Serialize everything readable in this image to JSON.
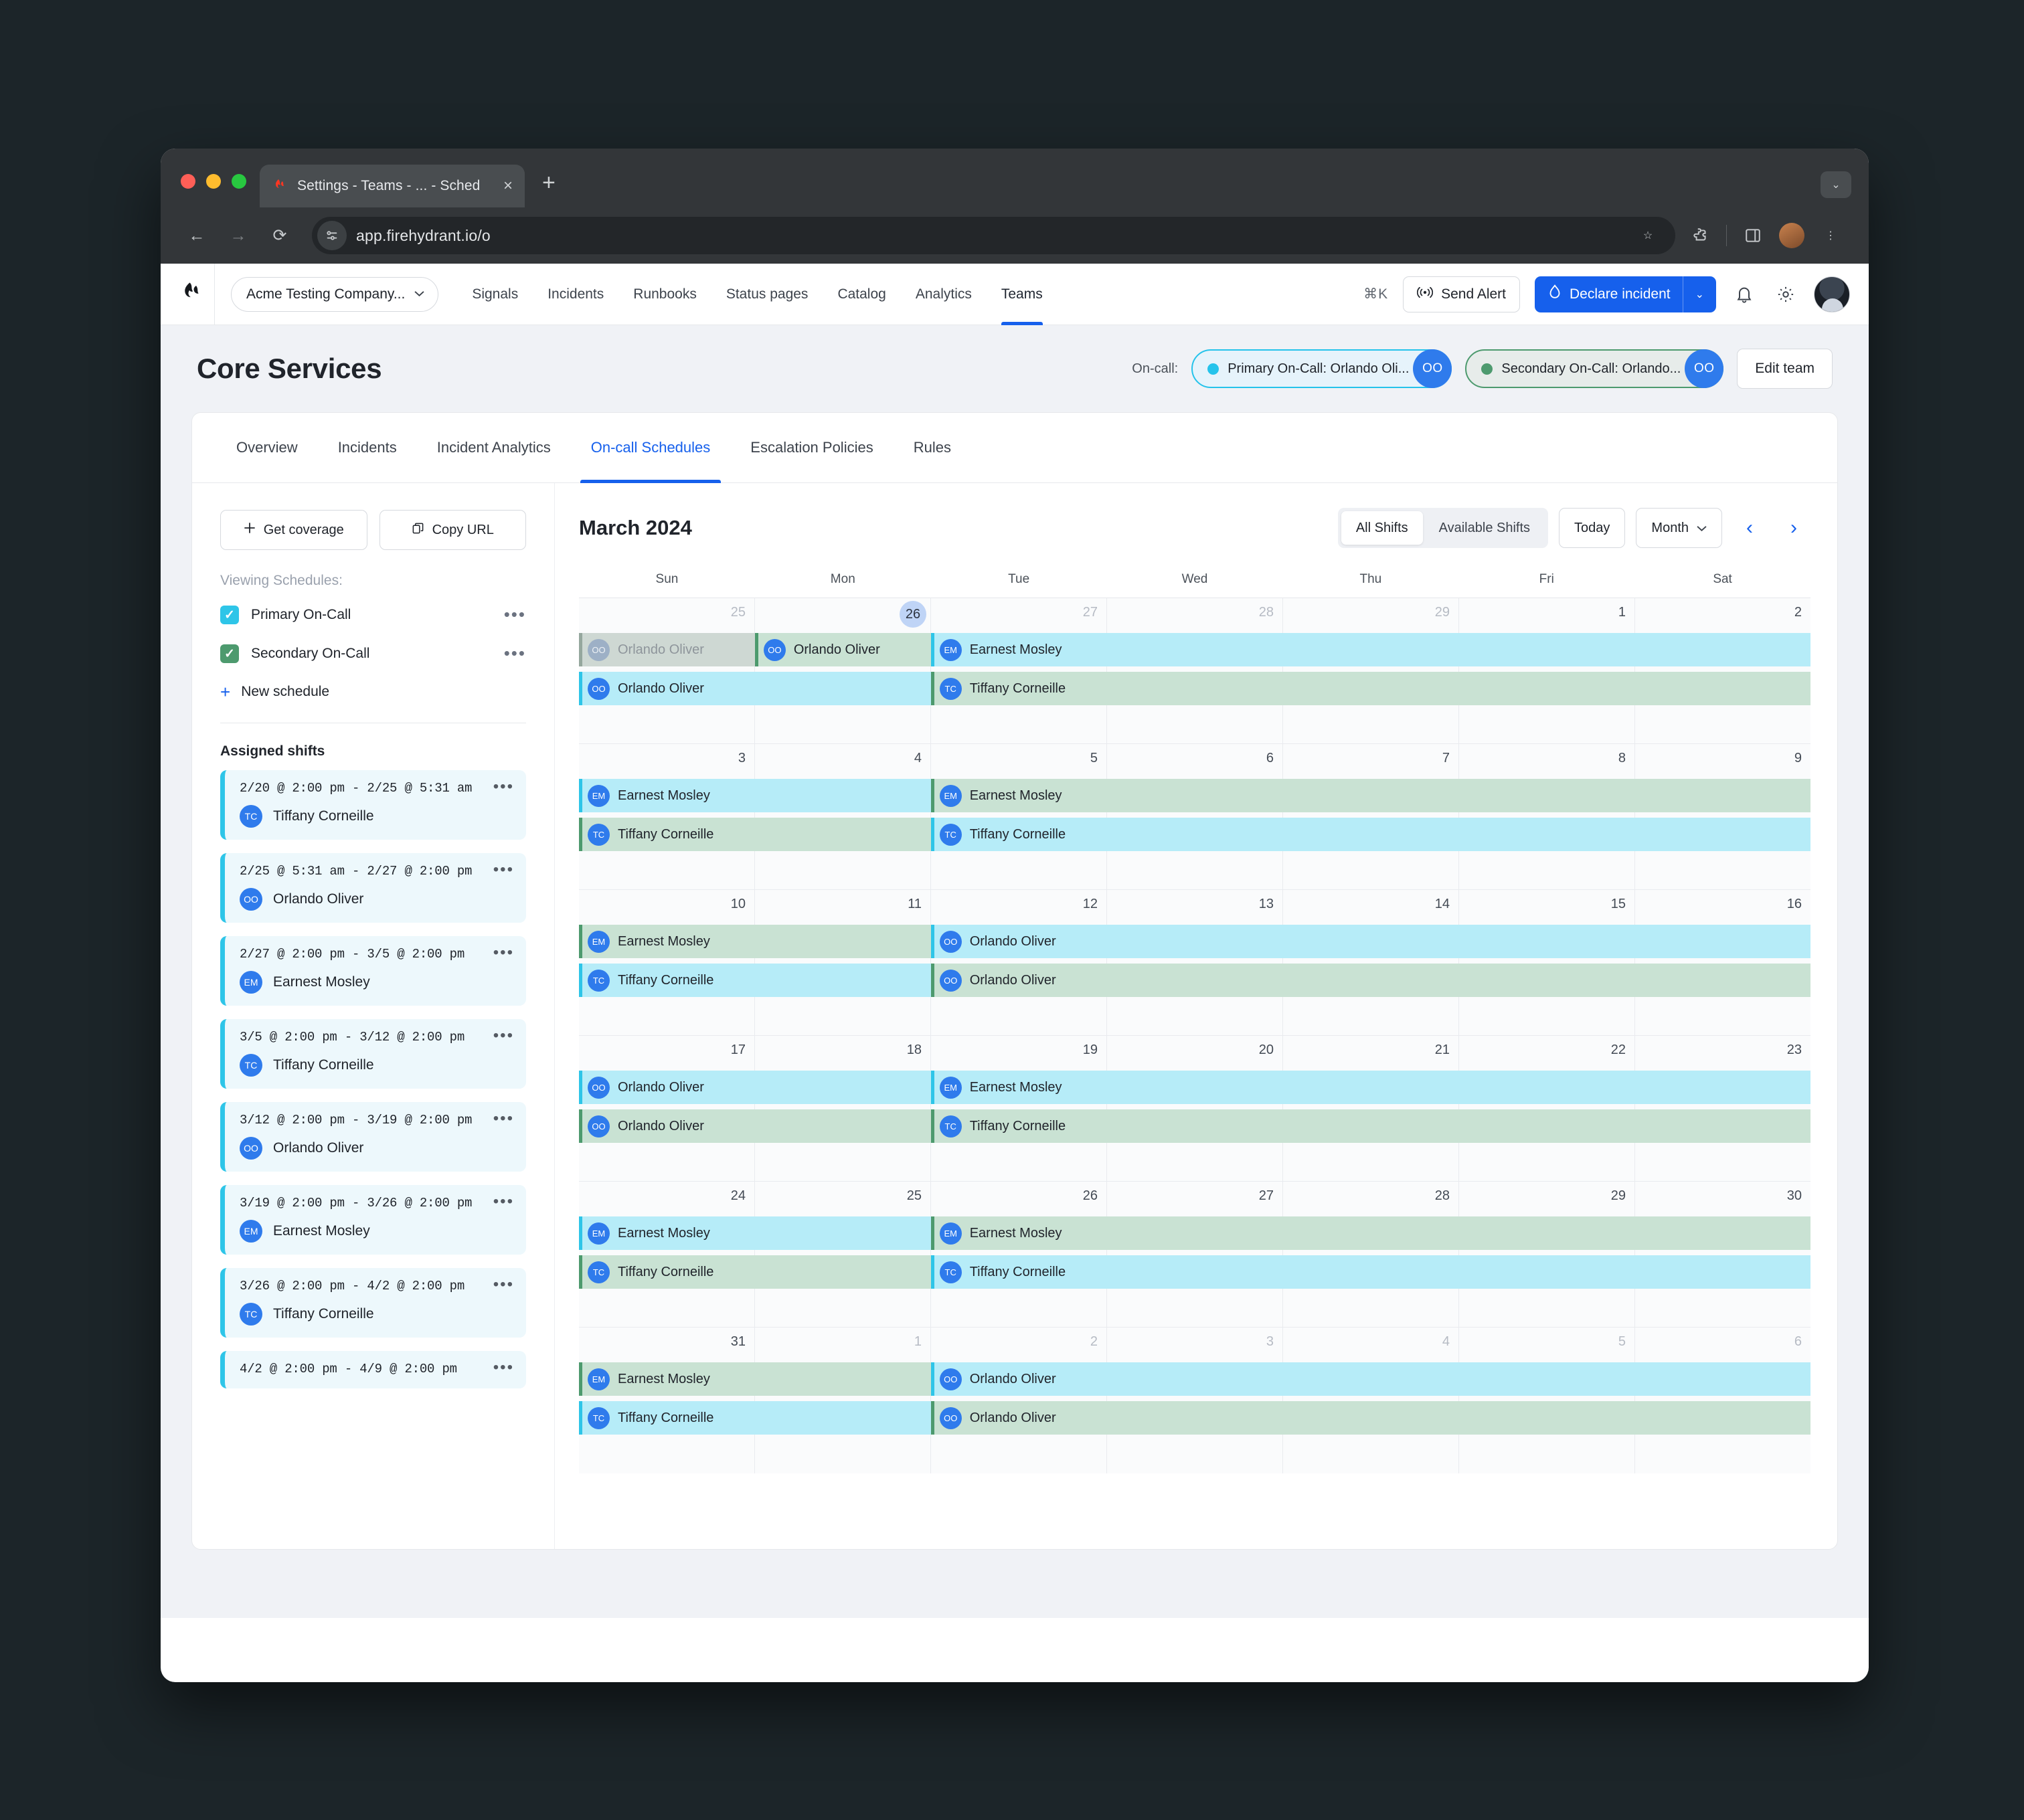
{
  "browser": {
    "tab_title": "Settings - Teams - ... - Sched",
    "tab_favicon": "firehydrant-logo-icon",
    "close_label": "×",
    "newtab_label": "+",
    "window_chevron": "⌄",
    "back": "←",
    "forward": "→",
    "reload": "⟳",
    "url": "app.firehydrant.io/o",
    "star": "☆",
    "menu": "⋮"
  },
  "appnav": {
    "org": "Acme Testing Company...",
    "links": [
      "Signals",
      "Incidents",
      "Runbooks",
      "Status pages",
      "Catalog",
      "Analytics",
      "Teams"
    ],
    "active_link": "Teams",
    "shortcut": "⌘K",
    "send_alert": "Send Alert",
    "declare_incident": "Declare incident",
    "declare_caret": "⌄"
  },
  "header": {
    "title": "Core Services",
    "oncall_label": "On-call:",
    "pills": [
      {
        "text": "Primary On-Call: Orlando Oli...",
        "initials": "OO",
        "color": "#25c3eb"
      },
      {
        "text": "Secondary On-Call: Orlando...",
        "initials": "OO",
        "color": "#4d9a6e"
      }
    ],
    "edit_team": "Edit team"
  },
  "tabs": {
    "items": [
      "Overview",
      "Incidents",
      "Incident Analytics",
      "On-call Schedules",
      "Escalation Policies",
      "Rules"
    ],
    "active": "On-call Schedules"
  },
  "sidebar": {
    "get_coverage": "Get coverage",
    "copy_url": "Copy URL",
    "viewing_label": "Viewing Schedules:",
    "schedules": [
      {
        "name": "Primary On-Call",
        "checked": true,
        "color": "#2ec5e8"
      },
      {
        "name": "Secondary On-Call",
        "checked": true,
        "color": "#4d9a6e"
      }
    ],
    "new_schedule": "New schedule",
    "assigned_title": "Assigned shifts",
    "shifts": [
      {
        "time": "2/20 @ 2:00 pm - 2/25 @ 5:31 am",
        "person": "Tiffany Corneille",
        "initials": "TC"
      },
      {
        "time": "2/25 @ 5:31 am - 2/27 @ 2:00 pm",
        "person": "Orlando Oliver",
        "initials": "OO"
      },
      {
        "time": "2/27 @ 2:00 pm - 3/5 @ 2:00 pm",
        "person": "Earnest Mosley",
        "initials": "EM"
      },
      {
        "time": "3/5 @ 2:00 pm - 3/12 @ 2:00 pm",
        "person": "Tiffany Corneille",
        "initials": "TC"
      },
      {
        "time": "3/12 @ 2:00 pm - 3/19 @ 2:00 pm",
        "person": "Orlando Oliver",
        "initials": "OO"
      },
      {
        "time": "3/19 @ 2:00 pm - 3/26 @ 2:00 pm",
        "person": "Earnest Mosley",
        "initials": "EM"
      },
      {
        "time": "3/26 @ 2:00 pm - 4/2 @ 2:00 pm",
        "person": "Tiffany Corneille",
        "initials": "TC"
      },
      {
        "time": "4/2 @ 2:00 pm - 4/9 @ 2:00 pm",
        "person": "",
        "initials": ""
      }
    ],
    "dots": "•••"
  },
  "calendar": {
    "month": "March 2024",
    "segments": [
      "All Shifts",
      "Available Shifts"
    ],
    "segment_active": "All Shifts",
    "today": "Today",
    "view": "Month",
    "prev": "‹",
    "next": "›",
    "dow": [
      "Sun",
      "Mon",
      "Tue",
      "Wed",
      "Thu",
      "Fri",
      "Sat"
    ],
    "weeks": [
      {
        "days": [
          {
            "n": "25",
            "muted": true
          },
          {
            "n": "26",
            "today": true
          },
          {
            "n": "27",
            "muted": true
          },
          {
            "n": "28",
            "muted": true
          },
          {
            "n": "29",
            "muted": true
          },
          {
            "n": "1"
          },
          {
            "n": "2"
          }
        ],
        "rows": [
          [
            {
              "person": "Orlando Oliver",
              "initials": "OO",
              "start": 0,
              "span": 1,
              "style": "past"
            },
            {
              "person": "Orlando Oliver",
              "initials": "OO",
              "start": 1,
              "span": 1,
              "style": "green"
            },
            {
              "person": "Earnest Mosley",
              "initials": "EM",
              "start": 2,
              "span": 5,
              "style": "cyan"
            }
          ],
          [
            {
              "person": "Orlando Oliver",
              "initials": "OO",
              "start": 0,
              "span": 2,
              "style": "cyan"
            },
            {
              "person": "Tiffany Corneille",
              "initials": "TC",
              "start": 2,
              "span": 5,
              "style": "green"
            }
          ]
        ]
      },
      {
        "days": [
          {
            "n": "3"
          },
          {
            "n": "4"
          },
          {
            "n": "5"
          },
          {
            "n": "6"
          },
          {
            "n": "7"
          },
          {
            "n": "8"
          },
          {
            "n": "9"
          }
        ],
        "rows": [
          [
            {
              "person": "Earnest Mosley",
              "initials": "EM",
              "start": 0,
              "span": 2,
              "style": "cyan"
            },
            {
              "person": "Earnest Mosley",
              "initials": "EM",
              "start": 2,
              "span": 5,
              "style": "green"
            }
          ],
          [
            {
              "person": "Tiffany Corneille",
              "initials": "TC",
              "start": 0,
              "span": 2,
              "style": "green"
            },
            {
              "person": "Tiffany Corneille",
              "initials": "TC",
              "start": 2,
              "span": 5,
              "style": "cyan"
            }
          ]
        ]
      },
      {
        "days": [
          {
            "n": "10"
          },
          {
            "n": "11"
          },
          {
            "n": "12"
          },
          {
            "n": "13"
          },
          {
            "n": "14"
          },
          {
            "n": "15"
          },
          {
            "n": "16"
          }
        ],
        "rows": [
          [
            {
              "person": "Earnest Mosley",
              "initials": "EM",
              "start": 0,
              "span": 2,
              "style": "green"
            },
            {
              "person": "Orlando Oliver",
              "initials": "OO",
              "start": 2,
              "span": 5,
              "style": "cyan"
            }
          ],
          [
            {
              "person": "Tiffany Corneille",
              "initials": "TC",
              "start": 0,
              "span": 2,
              "style": "cyan"
            },
            {
              "person": "Orlando Oliver",
              "initials": "OO",
              "start": 2,
              "span": 5,
              "style": "green"
            }
          ]
        ]
      },
      {
        "days": [
          {
            "n": "17"
          },
          {
            "n": "18"
          },
          {
            "n": "19"
          },
          {
            "n": "20"
          },
          {
            "n": "21"
          },
          {
            "n": "22"
          },
          {
            "n": "23"
          }
        ],
        "rows": [
          [
            {
              "person": "Orlando Oliver",
              "initials": "OO",
              "start": 0,
              "span": 2,
              "style": "cyan"
            },
            {
              "person": "Earnest Mosley",
              "initials": "EM",
              "start": 2,
              "span": 5,
              "style": "cyan"
            }
          ],
          [
            {
              "person": "Orlando Oliver",
              "initials": "OO",
              "start": 0,
              "span": 2,
              "style": "green"
            },
            {
              "person": "Tiffany Corneille",
              "initials": "TC",
              "start": 2,
              "span": 5,
              "style": "green"
            }
          ]
        ]
      },
      {
        "days": [
          {
            "n": "24"
          },
          {
            "n": "25"
          },
          {
            "n": "26"
          },
          {
            "n": "27"
          },
          {
            "n": "28"
          },
          {
            "n": "29"
          },
          {
            "n": "30"
          }
        ],
        "rows": [
          [
            {
              "person": "Earnest Mosley",
              "initials": "EM",
              "start": 0,
              "span": 2,
              "style": "cyan"
            },
            {
              "person": "Earnest Mosley",
              "initials": "EM",
              "start": 2,
              "span": 5,
              "style": "green"
            }
          ],
          [
            {
              "person": "Tiffany Corneille",
              "initials": "TC",
              "start": 0,
              "span": 2,
              "style": "green"
            },
            {
              "person": "Tiffany Corneille",
              "initials": "TC",
              "start": 2,
              "span": 5,
              "style": "cyan"
            }
          ]
        ]
      },
      {
        "days": [
          {
            "n": "31"
          },
          {
            "n": "1",
            "muted": true
          },
          {
            "n": "2",
            "muted": true
          },
          {
            "n": "3",
            "muted": true
          },
          {
            "n": "4",
            "muted": true
          },
          {
            "n": "5",
            "muted": true
          },
          {
            "n": "6",
            "muted": true
          }
        ],
        "rows": [
          [
            {
              "person": "Earnest Mosley",
              "initials": "EM",
              "start": 0,
              "span": 2,
              "style": "green"
            },
            {
              "person": "Orlando Oliver",
              "initials": "OO",
              "start": 2,
              "span": 5,
              "style": "cyan"
            }
          ],
          [
            {
              "person": "Tiffany Corneille",
              "initials": "TC",
              "start": 0,
              "span": 2,
              "style": "cyan"
            },
            {
              "person": "Orlando Oliver",
              "initials": "OO",
              "start": 2,
              "span": 5,
              "style": "green"
            }
          ]
        ]
      }
    ]
  }
}
